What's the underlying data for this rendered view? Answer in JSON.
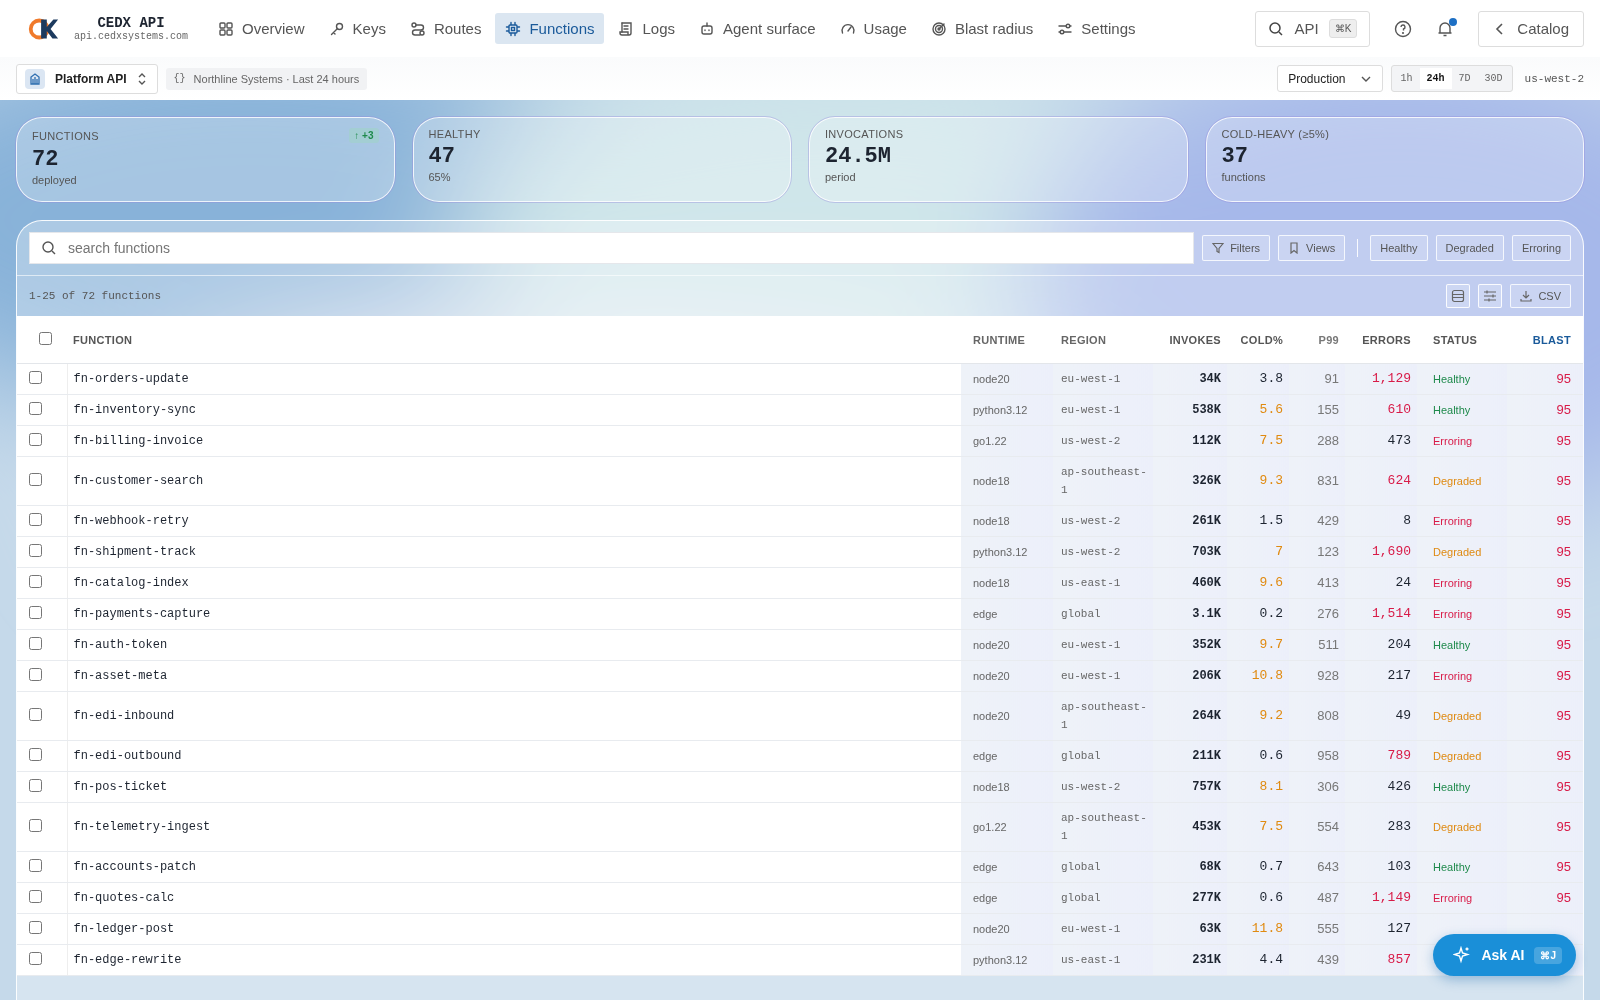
{
  "brand": {
    "name": "CEDX API",
    "host": "api.cedxsystems.com"
  },
  "nav": [
    {
      "label": "Overview",
      "selected": false
    },
    {
      "label": "Keys",
      "selected": false
    },
    {
      "label": "Routes",
      "selected": false
    },
    {
      "label": "Functions",
      "selected": true
    },
    {
      "label": "Logs",
      "selected": false
    },
    {
      "label": "Agent surface",
      "selected": false
    },
    {
      "label": "Usage",
      "selected": false
    },
    {
      "label": "Blast radius",
      "selected": false
    },
    {
      "label": "Settings",
      "selected": false
    }
  ],
  "command": {
    "label": "API",
    "shortcut": "⌘K"
  },
  "notifications": {
    "unread": true
  },
  "catalog_button": "Catalog",
  "project": "Platform API",
  "context": {
    "icon": "{}",
    "text": "Northline Systems · Last 24 hours"
  },
  "environment": "Production",
  "ranges": [
    {
      "label": "1h",
      "selected": false
    },
    {
      "label": "24h",
      "selected": true
    },
    {
      "label": "7D",
      "selected": false
    },
    {
      "label": "30D",
      "selected": false
    }
  ],
  "region": "us-west-2",
  "kpis": [
    {
      "label": "FUNCTIONS",
      "value": "72",
      "sub": "deployed",
      "delta": "↑ +3"
    },
    {
      "label": "HEALTHY",
      "value": "47",
      "sub": "65%"
    },
    {
      "label": "INVOCATIONS",
      "value": "24.5M",
      "sub": "period"
    },
    {
      "label": "COLD-HEAVY (≥5%)",
      "value": "37",
      "sub": "functions"
    }
  ],
  "search": {
    "placeholder": "search functions"
  },
  "tools": [
    "Filters",
    "Views"
  ],
  "status_filters": [
    "Healthy",
    "Degraded",
    "Erroring"
  ],
  "count": "1-25 of 72 functions",
  "export": "CSV",
  "table": {
    "header_checked": false,
    "columns": [
      "FUNCTION",
      "RUNTIME",
      "REGION",
      "INVOKES",
      "COLD%",
      "P99",
      "ERRORS",
      "STATUS",
      "BLAST"
    ],
    "rows": [
      {
        "checked": false,
        "name": "fn-orders-update",
        "runtime": "node20",
        "region": "eu-west-1",
        "invokes": "34K",
        "cold": "3.8",
        "cold_high": false,
        "p99": "91",
        "errors": "1,129",
        "errors_high": true,
        "status": "Healthy",
        "color": "#1f8a4c",
        "blast": "95"
      },
      {
        "checked": false,
        "name": "fn-inventory-sync",
        "runtime": "python3.12",
        "region": "eu-west-1",
        "invokes": "538K",
        "cold": "5.6",
        "cold_high": true,
        "p99": "155",
        "errors": "610",
        "errors_high": true,
        "status": "Healthy",
        "color": "#1f8a4c",
        "blast": "95"
      },
      {
        "checked": false,
        "name": "fn-billing-invoice",
        "runtime": "go1.22",
        "region": "us-west-2",
        "invokes": "112K",
        "cold": "7.5",
        "cold_high": true,
        "p99": "288",
        "errors": "473",
        "errors_high": false,
        "status": "Erroring",
        "color": "#d81b48",
        "blast": "95"
      },
      {
        "checked": false,
        "name": "fn-customer-search",
        "runtime": "node18",
        "region": "ap-southeast-1",
        "invokes": "326K",
        "cold": "9.3",
        "cold_high": true,
        "p99": "831",
        "errors": "624",
        "errors_high": true,
        "status": "Degraded",
        "color": "#df8a12",
        "blast": "95"
      },
      {
        "checked": false,
        "name": "fn-webhook-retry",
        "runtime": "node18",
        "region": "us-west-2",
        "invokes": "261K",
        "cold": "1.5",
        "cold_high": false,
        "p99": "429",
        "errors": "8",
        "errors_high": false,
        "status": "Erroring",
        "color": "#d81b48",
        "blast": "95"
      },
      {
        "checked": false,
        "name": "fn-shipment-track",
        "runtime": "python3.12",
        "region": "us-west-2",
        "invokes": "703K",
        "cold": "7",
        "cold_high": true,
        "p99": "123",
        "errors": "1,690",
        "errors_high": true,
        "status": "Degraded",
        "color": "#df8a12",
        "blast": "95"
      },
      {
        "checked": false,
        "name": "fn-catalog-index",
        "runtime": "node18",
        "region": "us-east-1",
        "invokes": "460K",
        "cold": "9.6",
        "cold_high": true,
        "p99": "413",
        "errors": "24",
        "errors_high": false,
        "status": "Erroring",
        "color": "#d81b48",
        "blast": "95"
      },
      {
        "checked": false,
        "name": "fn-payments-capture",
        "runtime": "edge",
        "region": "global",
        "invokes": "3.1K",
        "cold": "0.2",
        "cold_high": false,
        "p99": "276",
        "errors": "1,514",
        "errors_high": true,
        "status": "Erroring",
        "color": "#d81b48",
        "blast": "95"
      },
      {
        "checked": false,
        "name": "fn-auth-token",
        "runtime": "node20",
        "region": "eu-west-1",
        "invokes": "352K",
        "cold": "9.7",
        "cold_high": true,
        "p99": "511",
        "errors": "204",
        "errors_high": false,
        "status": "Healthy",
        "color": "#1f8a4c",
        "blast": "95"
      },
      {
        "checked": false,
        "name": "fn-asset-meta",
        "runtime": "node20",
        "region": "eu-west-1",
        "invokes": "206K",
        "cold": "10.8",
        "cold_high": true,
        "p99": "928",
        "errors": "217",
        "errors_high": false,
        "status": "Erroring",
        "color": "#d81b48",
        "blast": "95"
      },
      {
        "checked": false,
        "name": "fn-edi-inbound",
        "runtime": "node20",
        "region": "ap-southeast-1",
        "invokes": "264K",
        "cold": "9.2",
        "cold_high": true,
        "p99": "808",
        "errors": "49",
        "errors_high": false,
        "status": "Degraded",
        "color": "#df8a12",
        "blast": "95"
      },
      {
        "checked": false,
        "name": "fn-edi-outbound",
        "runtime": "edge",
        "region": "global",
        "invokes": "211K",
        "cold": "0.6",
        "cold_high": false,
        "p99": "958",
        "errors": "789",
        "errors_high": true,
        "status": "Degraded",
        "color": "#df8a12",
        "blast": "95"
      },
      {
        "checked": false,
        "name": "fn-pos-ticket",
        "runtime": "node18",
        "region": "us-west-2",
        "invokes": "757K",
        "cold": "8.1",
        "cold_high": true,
        "p99": "306",
        "errors": "426",
        "errors_high": false,
        "status": "Healthy",
        "color": "#1f8a4c",
        "blast": "95"
      },
      {
        "checked": false,
        "name": "fn-telemetry-ingest",
        "runtime": "go1.22",
        "region": "ap-southeast-1",
        "invokes": "453K",
        "cold": "7.5",
        "cold_high": true,
        "p99": "554",
        "errors": "283",
        "errors_high": false,
        "status": "Degraded",
        "color": "#df8a12",
        "blast": "95"
      },
      {
        "checked": false,
        "name": "fn-accounts-patch",
        "runtime": "edge",
        "region": "global",
        "invokes": "68K",
        "cold": "0.7",
        "cold_high": false,
        "p99": "643",
        "errors": "103",
        "errors_high": false,
        "status": "Healthy",
        "color": "#1f8a4c",
        "blast": "95"
      },
      {
        "checked": false,
        "name": "fn-quotes-calc",
        "runtime": "edge",
        "region": "global",
        "invokes": "277K",
        "cold": "0.6",
        "cold_high": false,
        "p99": "487",
        "errors": "1,149",
        "errors_high": true,
        "status": "Erroring",
        "color": "#d81b48",
        "blast": "95"
      },
      {
        "checked": false,
        "name": "fn-ledger-post",
        "runtime": "node20",
        "region": "eu-west-1",
        "invokes": "63K",
        "cold": "11.8",
        "cold_high": true,
        "p99": "555",
        "errors": "127",
        "errors_high": false
      },
      {
        "checked": false,
        "name": "fn-edge-rewrite",
        "runtime": "python3.12",
        "region": "us-east-1",
        "invokes": "231K",
        "cold": "4.4",
        "cold_high": false,
        "p99": "439",
        "errors": "857",
        "errors_high": true
      }
    ]
  },
  "assistant": {
    "label": "Ask AI",
    "shortcut": "⌘J"
  }
}
